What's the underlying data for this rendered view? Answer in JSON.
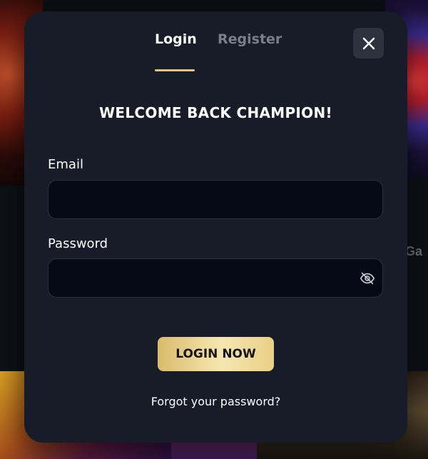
{
  "tabs": {
    "login": "Login",
    "register": "Register",
    "active": "login"
  },
  "modal": {
    "heading": "WELCOME BACK CHAMPION!",
    "email_label": "Email",
    "email_value": "",
    "email_placeholder": "",
    "password_label": "Password",
    "password_value": "",
    "password_placeholder": "",
    "login_button": "LOGIN NOW",
    "forgot_link": "Forgot your password?"
  },
  "background": {
    "partial_text_right": "Ga"
  },
  "icons": {
    "close": "close-icon",
    "password_toggle": "eye-slash-icon"
  },
  "colors": {
    "modal_bg": "#171c28",
    "input_bg": "#060a14",
    "accent_gold": "#e6c37c",
    "inactive_tab": "#7a7f8a"
  }
}
